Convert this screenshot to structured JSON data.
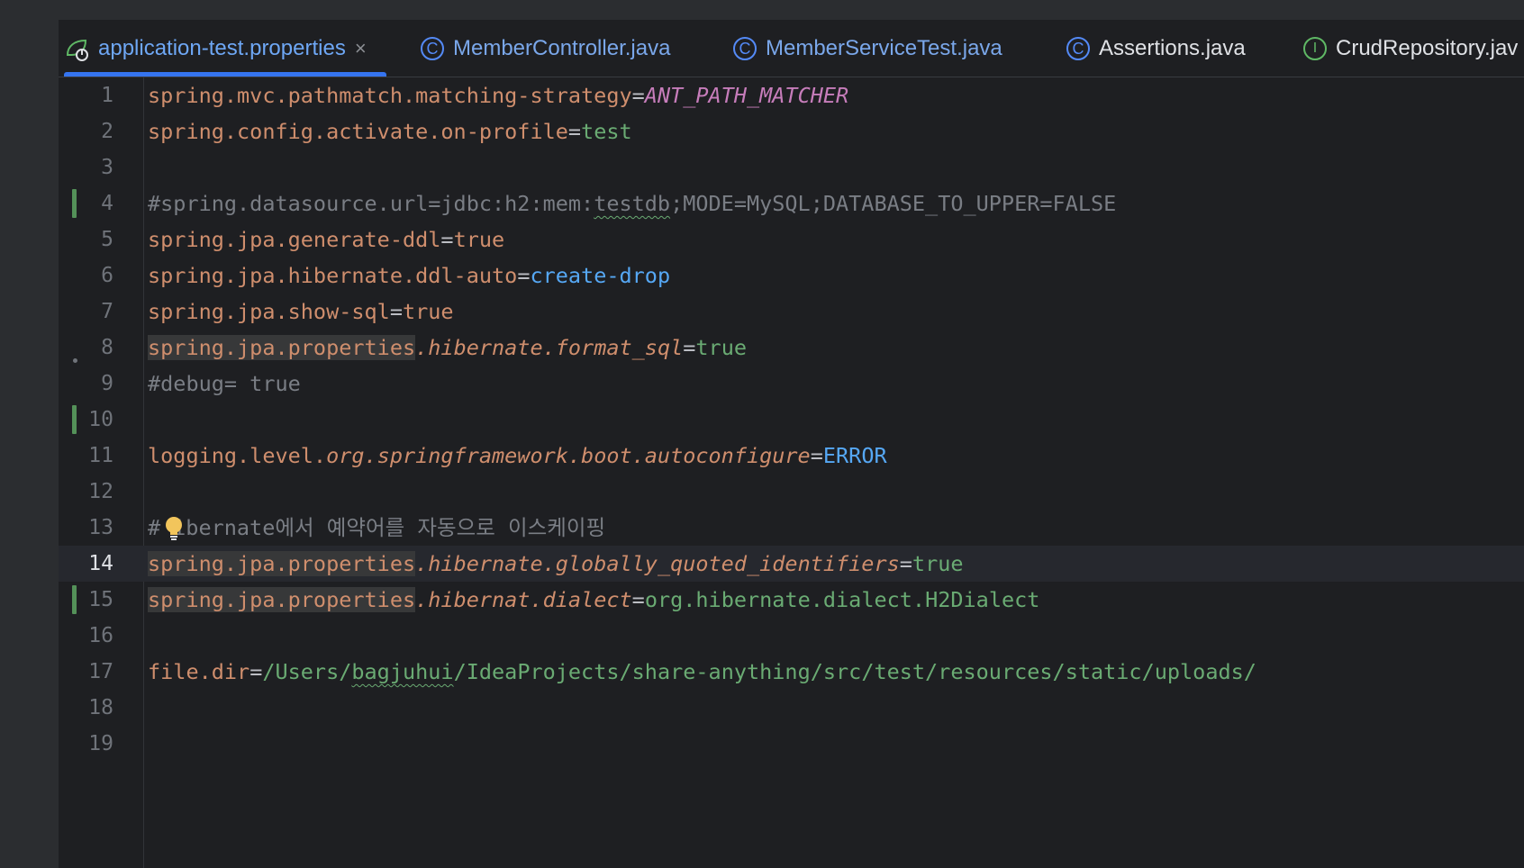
{
  "tabs": [
    {
      "label": "application-test.properties",
      "icon": "spring-properties-icon",
      "active": true,
      "closable": true
    },
    {
      "label": "MemberController.java",
      "icon": "class-icon",
      "icon_letter": "C"
    },
    {
      "label": "MemberServiceTest.java",
      "icon": "class-icon",
      "icon_letter": "C"
    },
    {
      "label": "Assertions.java",
      "icon": "class-icon",
      "icon_letter": "C"
    },
    {
      "label": "CrudRepository.jav",
      "icon": "interface-icon",
      "icon_letter": "I"
    }
  ],
  "tab_close_glyph": "×",
  "current_line": 14,
  "colors": {
    "key": "#cf8e6d",
    "value": "#6aab73",
    "comment": "#7a7e85",
    "accent": "#3574f0",
    "change_marker": "#549159"
  },
  "lines": {
    "l1": {
      "num": "1",
      "key": "spring.mvc.pathmatch.matching-strategy",
      "eq": "=",
      "value": "ANT_PATH_MATCHER"
    },
    "l2": {
      "num": "2",
      "key": "spring.config.activate.on-profile",
      "eq": "=",
      "value": "test"
    },
    "l3": {
      "num": "3"
    },
    "l4": {
      "num": "4",
      "comment_a": "#spring.datasource.url=jdbc:h2:mem:",
      "comment_b": "testdb",
      "comment_c": ";MODE=MySQL;DATABASE_TO_UPPER=FALSE"
    },
    "l5": {
      "num": "5",
      "key": "spring.jpa.generate-ddl",
      "eq": "=",
      "value": "true"
    },
    "l6": {
      "num": "6",
      "key": "spring.jpa.hibernate.ddl-auto",
      "eq": "=",
      "value": "create-drop"
    },
    "l7": {
      "num": "7",
      "key": "spring.jpa.show-sql",
      "eq": "=",
      "value": "true"
    },
    "l8": {
      "num": "8",
      "key_a": "spring.jpa.properties",
      "key_b": ".hibernate.format_sql",
      "eq": "=",
      "value": "true"
    },
    "l9": {
      "num": "9",
      "comment": "#debug= true"
    },
    "l10": {
      "num": "10"
    },
    "l11": {
      "num": "11",
      "key_a": "logging.level.",
      "key_b": "org.springframework.boot.autoconfigure",
      "eq": "=",
      "value": "ERROR"
    },
    "l12": {
      "num": "12"
    },
    "l13": {
      "num": "13",
      "comment_a": "#",
      "comment_b": "ibernate에서 예약어를 자동으로 이스케이핑"
    },
    "l14": {
      "num": "14",
      "key_a": "spring.jpa.properties",
      "key_b": ".hibernate.globally_quoted_identifiers",
      "eq": "=",
      "value": "true"
    },
    "l15": {
      "num": "15",
      "key_a": "spring.jpa.properties",
      "key_b": ".hibernat.dialect",
      "eq": "=",
      "value": "org.hibernate.dialect.H2Dialect"
    },
    "l16": {
      "num": "16"
    },
    "l17": {
      "num": "17",
      "key": "file.dir",
      "eq": "=",
      "value_a": "/Users/",
      "value_b": "bagjuhui",
      "value_c": "/IdeaProjects/share-anything/src/test/resources/static/uploads/"
    },
    "l18": {
      "num": "18"
    },
    "l19": {
      "num": "19"
    }
  }
}
